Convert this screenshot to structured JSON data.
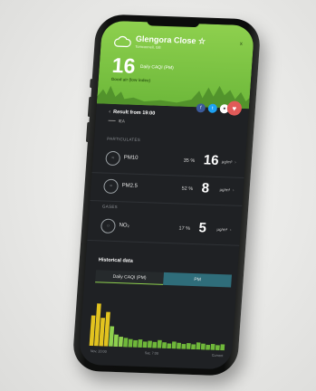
{
  "header": {
    "title": "Glengora Close",
    "title_mark": "☆",
    "subtitle": "Tomconnell, GB",
    "close_icon": "x",
    "value": "16",
    "value_label": "Daily CAQI (PM)",
    "status": "Good air (low index)"
  },
  "socials": [
    {
      "name": "facebook",
      "glyph": "f",
      "color": "#3b5998"
    },
    {
      "name": "twitter",
      "glyph": "t",
      "color": "#1da1f2"
    },
    {
      "name": "share",
      "glyph": "●",
      "color": "#ffffff"
    }
  ],
  "favorite_glyph": "♥",
  "result": {
    "label": "Result from 19:00",
    "source": "IEA"
  },
  "sections": {
    "particulates": "PARTICULATES",
    "gases": "GASES"
  },
  "rows": [
    {
      "name": "PM10",
      "percent": "35 %",
      "value": "16",
      "unit": "μg/m³",
      "icon": "wave-icon"
    },
    {
      "name": "PM2.5",
      "percent": "52 %",
      "value": "8",
      "unit": "μg/m³",
      "icon": "wave-icon"
    },
    {
      "name": "NO₂",
      "percent": "17 %",
      "value": "5",
      "unit": "μg/m³",
      "icon": "gas-icon"
    }
  ],
  "historical": {
    "title": "Historical data",
    "tabs": [
      "Daily CAQI (PM)",
      "PM"
    ],
    "active_tab": 0,
    "x_labels": [
      "Nov, 20:00",
      "Sat, 7:00",
      "Current"
    ]
  },
  "chart_data": {
    "type": "bar",
    "values": [
      30,
      42,
      28,
      34,
      20,
      12,
      10,
      9,
      8,
      7,
      8,
      6,
      7,
      6,
      8,
      6,
      5,
      7,
      6,
      5,
      6,
      5,
      7,
      6,
      5,
      6,
      5,
      6
    ],
    "color_levels": [
      "#e2c31f",
      "#e2c31f",
      "#e2c31f",
      "#e2c31f",
      "#8ed04e",
      "#8ed04e",
      "#8ed04e",
      "#6fb83a",
      "#6fb83a",
      "#6fb83a",
      "#6fb83a",
      "#6fb83a",
      "#6fb83a",
      "#6fb83a",
      "#6fb83a",
      "#6fb83a",
      "#6fb83a",
      "#6fb83a",
      "#6fb83a",
      "#6fb83a",
      "#6fb83a",
      "#6fb83a",
      "#6fb83a",
      "#6fb83a",
      "#6fb83a",
      "#6fb83a",
      "#6fb83a",
      "#6fb83a"
    ],
    "ylim": [
      0,
      50
    ]
  }
}
